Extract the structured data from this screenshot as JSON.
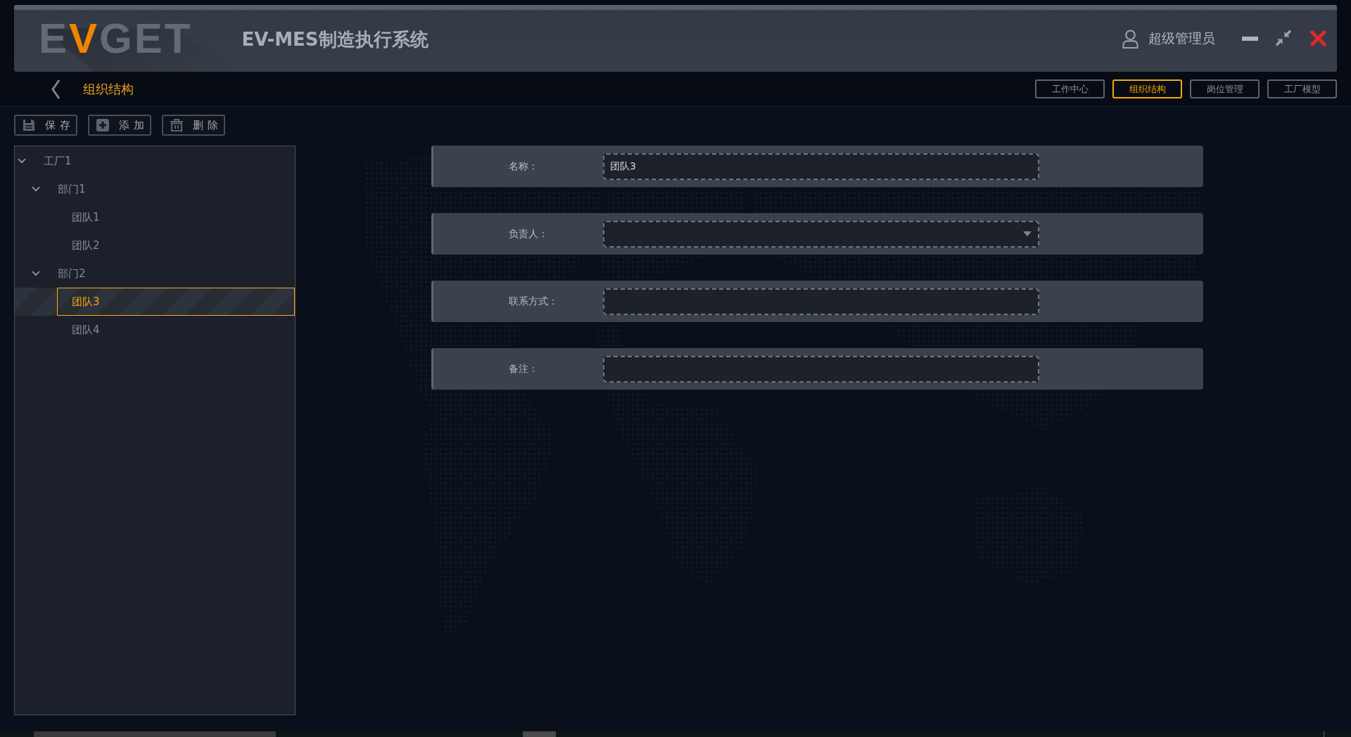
{
  "header": {
    "logo": [
      {
        "text": "E",
        "accent": false
      },
      {
        "text": "V",
        "accent": true
      },
      {
        "text": "GET",
        "accent": false
      }
    ],
    "title": "EV-MES制造执行系统",
    "user": "超级管理员"
  },
  "nav": {
    "title": "组织结构",
    "tabs": [
      {
        "label": "工作中心",
        "selected": false
      },
      {
        "label": "组织结构",
        "selected": true
      },
      {
        "label": "岗位管理",
        "selected": false
      },
      {
        "label": "工厂模型",
        "selected": false
      }
    ]
  },
  "toolbar": [
    {
      "kind": "save",
      "label": "保存"
    },
    {
      "kind": "add",
      "label": "添加"
    },
    {
      "kind": "delete",
      "label": "删除"
    }
  ],
  "tree": [
    {
      "label": "工厂1",
      "expanded": true,
      "selected": false,
      "children": [
        {
          "label": "部门1",
          "expanded": true,
          "selected": false,
          "children": [
            {
              "label": "团队1",
              "selected": false
            },
            {
              "label": "团队2",
              "selected": false
            }
          ]
        },
        {
          "label": "部门2",
          "expanded": true,
          "selected": false,
          "children": [
            {
              "label": "团队3",
              "selected": true
            },
            {
              "label": "团队4",
              "selected": false
            }
          ]
        }
      ]
    }
  ],
  "form": [
    {
      "kind": "text",
      "label": "名称：",
      "value": "团队3"
    },
    {
      "kind": "select",
      "label": "负责人："
    },
    {
      "kind": "text",
      "label": "联系方式："
    },
    {
      "kind": "text",
      "label": "备注："
    }
  ]
}
